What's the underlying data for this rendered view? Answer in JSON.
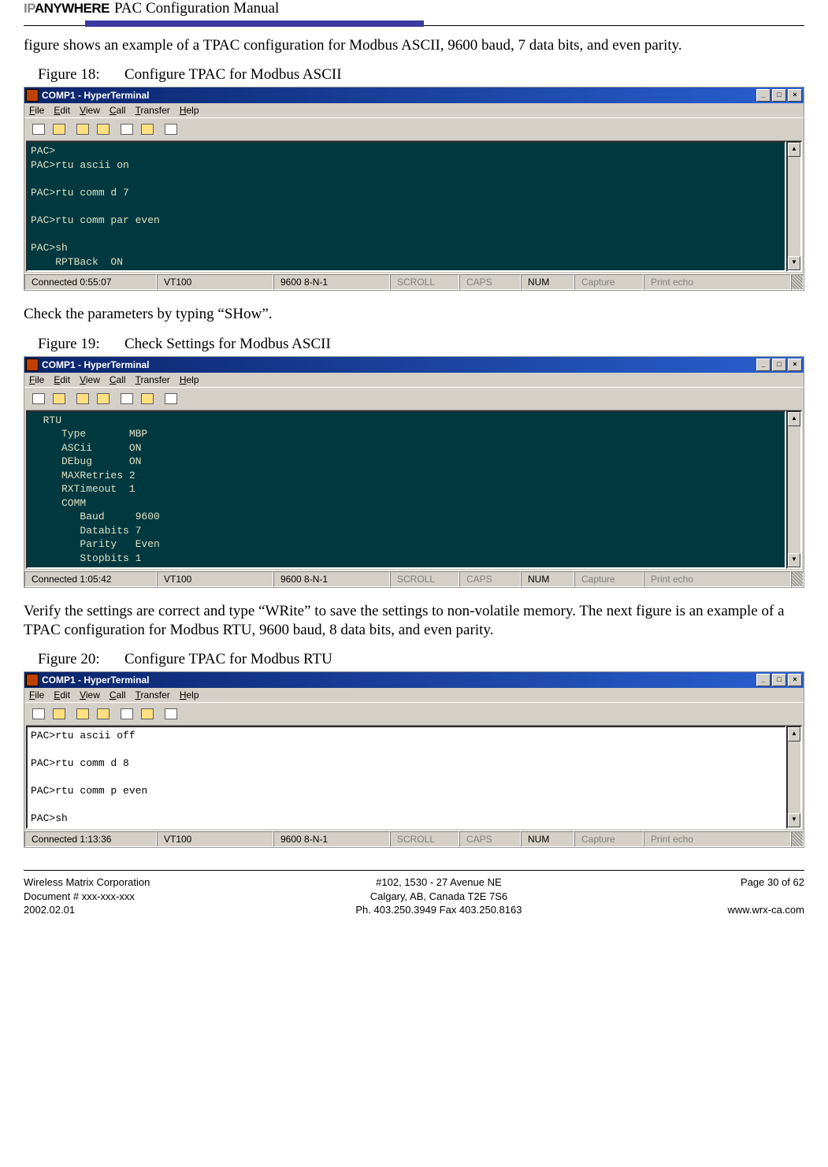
{
  "header": {
    "logo_text_1": "IP",
    "logo_text_2": "ANYWHERE",
    "doc_title": "PAC Configuration Manual"
  },
  "para_1": "figure shows an example of a TPAC configuration for Modbus ASCII, 9600 baud, 7 data bits, and even parity.",
  "fig18": {
    "num": "Figure 18:",
    "title": "Configure TPAC for Modbus ASCII"
  },
  "fig19": {
    "num": "Figure 19:",
    "title": "Check Settings for Modbus ASCII"
  },
  "fig20": {
    "num": "Figure 20:",
    "title": "Configure TPAC for Modbus RTU"
  },
  "para_2": "Check the parameters by typing “SHow”.",
  "para_3": "Verify the settings are correct and type “WRite” to save the settings to non-volatile memory. The next figure is an example of a TPAC configuration for Modbus RTU, 9600 baud, 8 data bits, and even parity.",
  "ht": {
    "title": "COMP1 - HyperTerminal",
    "menu": {
      "file": "File",
      "edit": "Edit",
      "view": "View",
      "call": "Call",
      "transfer": "Transfer",
      "help": "Help"
    },
    "winbtns": {
      "min": "_",
      "max": "□",
      "close": "×"
    }
  },
  "term18": "PAC>\nPAC>rtu ascii on\n\nPAC>rtu comm d 7\n\nPAC>rtu comm par even\n\nPAC>sh\n    RPTBack  ON",
  "term19": "  RTU\n     Type       MBP\n     ASCii      ON\n     DEbug      ON\n     MAXRetries 2\n     RXTimeout  1\n     COMM\n        Baud     9600\n        Databits 7\n        Parity   Even\n        Stopbits 1",
  "term20": "PAC>rtu ascii off\n\nPAC>rtu comm d 8\n\nPAC>rtu comm p even\n\nPAC>sh",
  "status18": {
    "conn": "Connected 0:55:07",
    "emu": "VT100",
    "ser": "9600 8-N-1",
    "scroll": "SCROLL",
    "caps": "CAPS",
    "num": "NUM",
    "capture": "Capture",
    "echo": "Print echo"
  },
  "status19": {
    "conn": "Connected 1:05:42",
    "emu": "VT100",
    "ser": "9600 8-N-1",
    "scroll": "SCROLL",
    "caps": "CAPS",
    "num": "NUM",
    "capture": "Capture",
    "echo": "Print echo"
  },
  "status20": {
    "conn": "Connected 1:13:36",
    "emu": "VT100",
    "ser": "9600 8-N-1",
    "scroll": "SCROLL",
    "caps": "CAPS",
    "num": "NUM",
    "capture": "Capture",
    "echo": "Print echo"
  },
  "footer": {
    "left": "Wireless Matrix Corporation\nDocument # xxx-xxx-xxx\n2002.02.01",
    "mid": "#102, 1530 - 27 Avenue NE\nCalgary, AB, Canada  T2E 7S6\nPh. 403.250.3949  Fax 403.250.8163",
    "right": "Page 30 of 62\n\nwww.wrx-ca.com"
  }
}
